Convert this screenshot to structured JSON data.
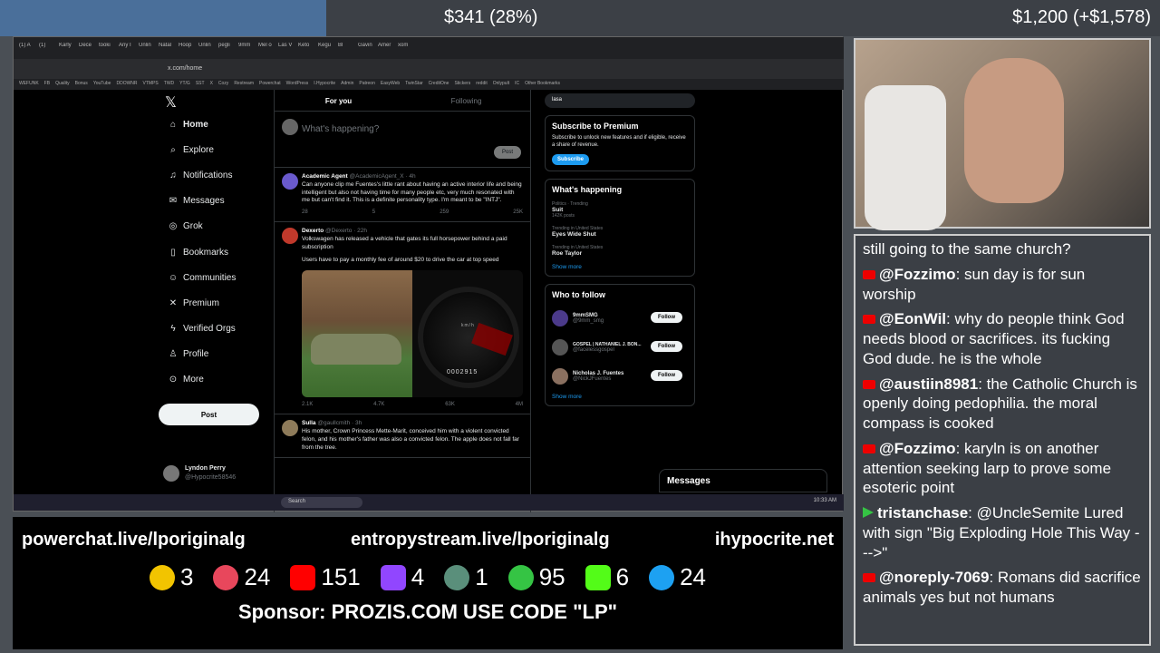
{
  "overlay": {
    "balance": "$341 (28%)",
    "goal": "$1,200 (+$1,578)"
  },
  "browser": {
    "tabs": [
      "(1) A",
      "(1)",
      "Karly",
      "Dece",
      "tooki",
      "Any I",
      "Unlin",
      "Natal",
      "Hoop",
      "Unlin",
      "pegli",
      "9mm",
      "Mel o",
      "Las V",
      "Keto",
      "Kegu",
      "Bl",
      "Gavin",
      "Amer",
      "xom"
    ],
    "url": "x.com/home",
    "bookmarks": [
      "WEFUNK",
      "FB",
      "Quality",
      "Bonus",
      "YouTube",
      "DDOWNR",
      "VTMPS",
      "TWD",
      "YT/G",
      "SST",
      "X",
      "Cozy",
      "Restream",
      "Powerchat",
      "WordPress",
      "I.Hypocrite",
      "Admin",
      "Patreon",
      "EasyWeb",
      "TwinStar",
      "CreditOne",
      "Stickers",
      "reddit",
      "Onlypult",
      "IC",
      "Other Bookmarks"
    ]
  },
  "nav": {
    "items": [
      "Home",
      "Explore",
      "Notifications",
      "Messages",
      "Grok",
      "Bookmarks",
      "Communities",
      "Premium",
      "Verified Orgs",
      "Profile",
      "More"
    ],
    "post": "Post",
    "user_name": "Lyndon Perry",
    "user_handle": "@Hypocrite58546"
  },
  "feed": {
    "tab_for_you": "For you",
    "tab_following": "Following",
    "compose_placeholder": "What's happening?",
    "compose_post": "Post",
    "tweets": [
      {
        "name": "Academic Agent",
        "meta": "@AcademicAgent_X · 4h",
        "text": "Can anyone clip me Fuentes's little rant about having an active interior life and being intelligent but also not having time for many people etc, very much resonated with me but can't find it. This is a definite personality type. I'm meant to be \"INTJ\".",
        "replies": "28",
        "retweets": "5",
        "likes": "259",
        "views": "25K"
      },
      {
        "name": "Dexerto",
        "meta": "@Dexerto · 22h",
        "text": "Volkswagen has released a vehicle that gates its full horsepower behind a paid subscription",
        "text2": "Users have to pay a monthly fee of around $20 to drive the car at top speed",
        "odometer": "0002915",
        "gauge_unit": "km/h",
        "replies": "2.1K",
        "retweets": "4.7K",
        "likes": "63K",
        "views": "4M"
      },
      {
        "name": "Sulla",
        "meta": "@gaullcmith · 3h",
        "text": "His mother, Crown Princess Mette-Marit, conceived him with a violent convicted felon, and his mother's father was also a convicted felon. The apple does not fall far from the tree."
      }
    ]
  },
  "right": {
    "search": "lasa",
    "premium_title": "Subscribe to Premium",
    "premium_text": "Subscribe to unlock new features and if eligible, receive a share of revenue.",
    "premium_btn": "Subscribe",
    "happening_title": "What's happening",
    "trends": [
      {
        "c": "Politics · Trending",
        "n": "Suit",
        "p": "142K posts"
      },
      {
        "c": "Trending in United States",
        "n": "Eyes Wide Shut",
        "p": ""
      },
      {
        "c": "Trending in United States",
        "n": "Roe Taylor",
        "p": ""
      }
    ],
    "show_more": "Show more",
    "wtf_title": "Who to follow",
    "follows": [
      {
        "n": "9mmSMG",
        "h": "@9mm_smg"
      },
      {
        "n": "GOSPEL | NATHANIEL J. BON...",
        "h": "@facelessgospel"
      },
      {
        "n": "Nicholas J. Fuentes",
        "h": "@NickJFuentes"
      }
    ],
    "follow_btn": "Follow",
    "show_more2": "Show more",
    "messages": "Messages"
  },
  "taskbar": {
    "search": "Search",
    "time": "10:33 AM"
  },
  "bottom": {
    "links": [
      "powerchat.live/lporiginalg",
      "entropystream.live/lporiginalg",
      "ihypocrite.net"
    ],
    "stats": [
      {
        "v": "3",
        "color": "#f2c400"
      },
      {
        "v": "24",
        "color": "#e8475c"
      },
      {
        "v": "151",
        "color": "#ff0000"
      },
      {
        "v": "4",
        "color": "#9146ff"
      },
      {
        "v": "1",
        "color": "#5a8f7b"
      },
      {
        "v": "95",
        "color": "#35c444"
      },
      {
        "v": "6",
        "color": "#53fc18"
      },
      {
        "v": "24",
        "color": "#1da1f2"
      }
    ],
    "sponsor": "Sponsor: PROZIS.COM USE CODE \"LP\""
  },
  "chat": [
    {
      "u": "",
      "t": "still going to the same church?"
    },
    {
      "u": "@Fozzimo",
      "t": ": sun day is for sun worship"
    },
    {
      "u": "@EonWil",
      "t": ": why do people think God needs blood or sacrifices. its fucking God dude. he is the whole"
    },
    {
      "u": "@austiin8981",
      "t": ": the Catholic Church is openly doing pedophilia. the moral compass is cooked"
    },
    {
      "u": "@Fozzimo",
      "t": ": karyln is on another attention seeking larp to prove some esoteric point"
    },
    {
      "u": "tristanchase",
      "t": ": @UncleSemite Lured with sign \"Big Exploding Hole This Way --->\""
    },
    {
      "u": "@noreply-7069",
      "t": ": Romans did sacrifice animals yes but not humans"
    }
  ]
}
